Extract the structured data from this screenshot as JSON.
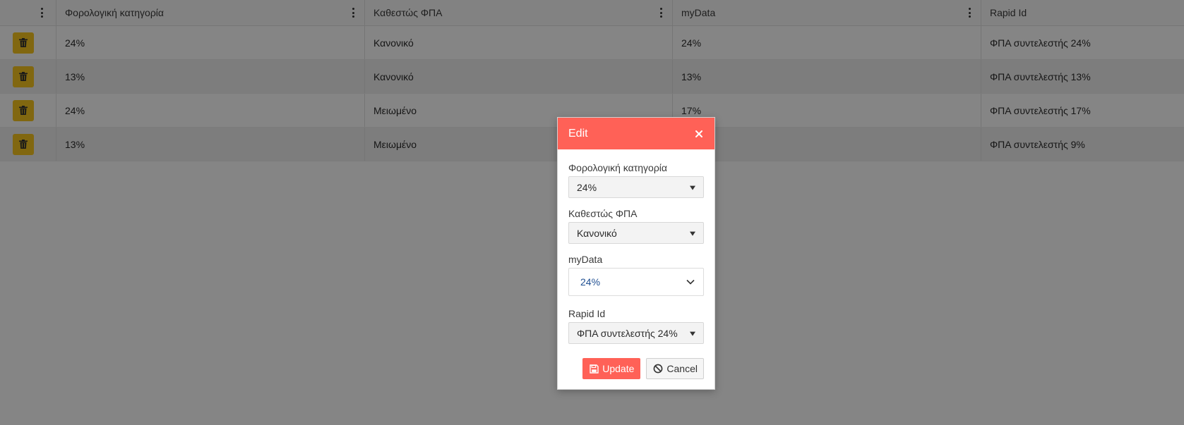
{
  "grid": {
    "columns": [
      {
        "title": ""
      },
      {
        "title": "Φορολογική κατηγορία"
      },
      {
        "title": "Καθεστώς ΦΠΑ"
      },
      {
        "title": "myData"
      },
      {
        "title": "Rapid Id"
      }
    ],
    "rows": [
      {
        "tax_category": "24%",
        "vat_regime": "Κανονικό",
        "mydata": "24%",
        "rapid_id": "ΦΠΑ συντελεστής 24%"
      },
      {
        "tax_category": "13%",
        "vat_regime": "Κανονικό",
        "mydata": "13%",
        "rapid_id": "ΦΠΑ συντελεστής 13%"
      },
      {
        "tax_category": "24%",
        "vat_regime": "Μειωμένο",
        "mydata": "17%",
        "rapid_id": "ΦΠΑ συντελεστής 17%"
      },
      {
        "tax_category": "13%",
        "vat_regime": "Μειωμένο",
        "mydata": "",
        "rapid_id": "ΦΠΑ συντελεστής 9%"
      }
    ]
  },
  "modal": {
    "title": "Edit",
    "fields": {
      "tax_category": {
        "label": "Φορολογική κατηγορία",
        "value": "24%"
      },
      "vat_regime": {
        "label": "Καθεστώς ΦΠΑ",
        "value": "Κανονικό"
      },
      "mydata": {
        "label": "myData",
        "value": "24%"
      },
      "rapid_id": {
        "label": "Rapid Id",
        "value": "ΦΠΑ συντελεστής 24%"
      }
    },
    "update_label": "Update",
    "cancel_label": "Cancel"
  },
  "colors": {
    "accent": "#ff6157",
    "delete_button": "#f7c51f",
    "overlay": "rgba(0,0,0,0.48)"
  },
  "icons": {
    "row_action": "trash-icon",
    "column_menu": "kebab-menu-icon",
    "close": "close-icon",
    "update": "save-icon",
    "cancel": "ban-icon",
    "select_caret": "caret-down-icon",
    "select_chevron": "chevron-down-icon"
  }
}
